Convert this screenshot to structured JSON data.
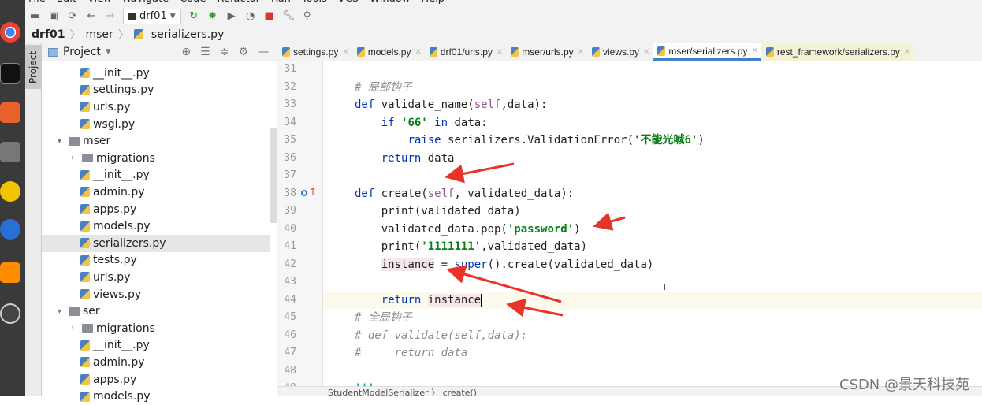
{
  "menu": [
    "File",
    "Edit",
    "View",
    "Navigate",
    "Code",
    "Refactor",
    "Run",
    "Tools",
    "VCS",
    "Window",
    "Help"
  ],
  "toolbar": {
    "run_config": "drf01"
  },
  "breadcrumb": [
    "drf01",
    "mser",
    "serializers.py"
  ],
  "project": {
    "title": "Project",
    "side_tab": "Project",
    "items": [
      {
        "label": "__init__.py",
        "level": 2,
        "type": "py"
      },
      {
        "label": "settings.py",
        "level": 2,
        "type": "py"
      },
      {
        "label": "urls.py",
        "level": 2,
        "type": "py"
      },
      {
        "label": "wsgi.py",
        "level": 2,
        "type": "py"
      },
      {
        "label": "mser",
        "level": 1,
        "type": "folder",
        "expanded": true
      },
      {
        "label": "migrations",
        "level": 2,
        "type": "folder",
        "expanded": false
      },
      {
        "label": "__init__.py",
        "level": 2,
        "type": "py"
      },
      {
        "label": "admin.py",
        "level": 2,
        "type": "py"
      },
      {
        "label": "apps.py",
        "level": 2,
        "type": "py"
      },
      {
        "label": "models.py",
        "level": 2,
        "type": "py"
      },
      {
        "label": "serializers.py",
        "level": 2,
        "type": "py",
        "selected": true
      },
      {
        "label": "tests.py",
        "level": 2,
        "type": "py"
      },
      {
        "label": "urls.py",
        "level": 2,
        "type": "py"
      },
      {
        "label": "views.py",
        "level": 2,
        "type": "py"
      },
      {
        "label": "ser",
        "level": 1,
        "type": "folder",
        "expanded": true
      },
      {
        "label": "migrations",
        "level": 2,
        "type": "folder",
        "expanded": false
      },
      {
        "label": "__init__.py",
        "level": 2,
        "type": "py"
      },
      {
        "label": "admin.py",
        "level": 2,
        "type": "py"
      },
      {
        "label": "apps.py",
        "level": 2,
        "type": "py"
      },
      {
        "label": "models.py",
        "level": 2,
        "type": "py"
      }
    ]
  },
  "tabs": [
    {
      "label": "settings.py"
    },
    {
      "label": "models.py"
    },
    {
      "label": "drf01/urls.py"
    },
    {
      "label": "mser/urls.py"
    },
    {
      "label": "views.py"
    },
    {
      "label": "mser/serializers.py",
      "active": true
    },
    {
      "label": "rest_framework/serializers.py",
      "highlighted": true
    }
  ],
  "editor": {
    "current_line": 44,
    "lines": [
      {
        "n": "31",
        "html": ""
      },
      {
        "n": "32",
        "html": "<span class='cm'># 局部钩子</span>"
      },
      {
        "n": "33",
        "html": "<span class='kw'>def</span> validate_name(<span class='sf'>self</span>,data):"
      },
      {
        "n": "34",
        "html": "    <span class='kw'>if</span> <span class='st'>'66'</span> <span class='kw'>in</span> data:"
      },
      {
        "n": "35",
        "html": "        <span class='kw'>raise</span> serializers.ValidationError(<span class='st'>'不能光喊6'</span>)"
      },
      {
        "n": "36",
        "html": "    <span class='kw'>return</span> data"
      },
      {
        "n": "37",
        "html": ""
      },
      {
        "n": "38",
        "html": "<span class='kw'>def</span> create(<span class='sf'>self</span>, validated_data):"
      },
      {
        "n": "39",
        "html": "    print(validated_data)"
      },
      {
        "n": "40",
        "html": "    validated_data.pop(<span class='st'>'password'</span>)"
      },
      {
        "n": "41",
        "html": "    print(<span class='st'>'1111111'</span>,validated_data)"
      },
      {
        "n": "42",
        "html": "    <span class='hlv'>instance</span> = <span class='kw'>super</span>().create(validated_data)"
      },
      {
        "n": "43",
        "html": ""
      },
      {
        "n": "44",
        "html": "    <span class='kw'>return</span> <span class='hlv'>instance</span>|"
      },
      {
        "n": "45",
        "html": "<span class='cm'># 全局钩子</span>"
      },
      {
        "n": "46",
        "html": "<span class='cm'># def validate(self,data):</span>"
      },
      {
        "n": "47",
        "html": "<span class='cm'>#     return data</span>"
      },
      {
        "n": "48",
        "html": ""
      },
      {
        "n": "49",
        "html": "<span class='st' style='color:#0aa'>'''</span>"
      }
    ]
  },
  "status": {
    "breadcrumb": "StudentModelSerializer  〉 create()"
  },
  "watermark": "CSDN @景天科技苑",
  "colors": {
    "keyword": "#0033b3",
    "string": "#067d17",
    "comment": "#8c8c8c",
    "annotation_arrow": "#e8332a",
    "active_tab": "#4083c9"
  }
}
